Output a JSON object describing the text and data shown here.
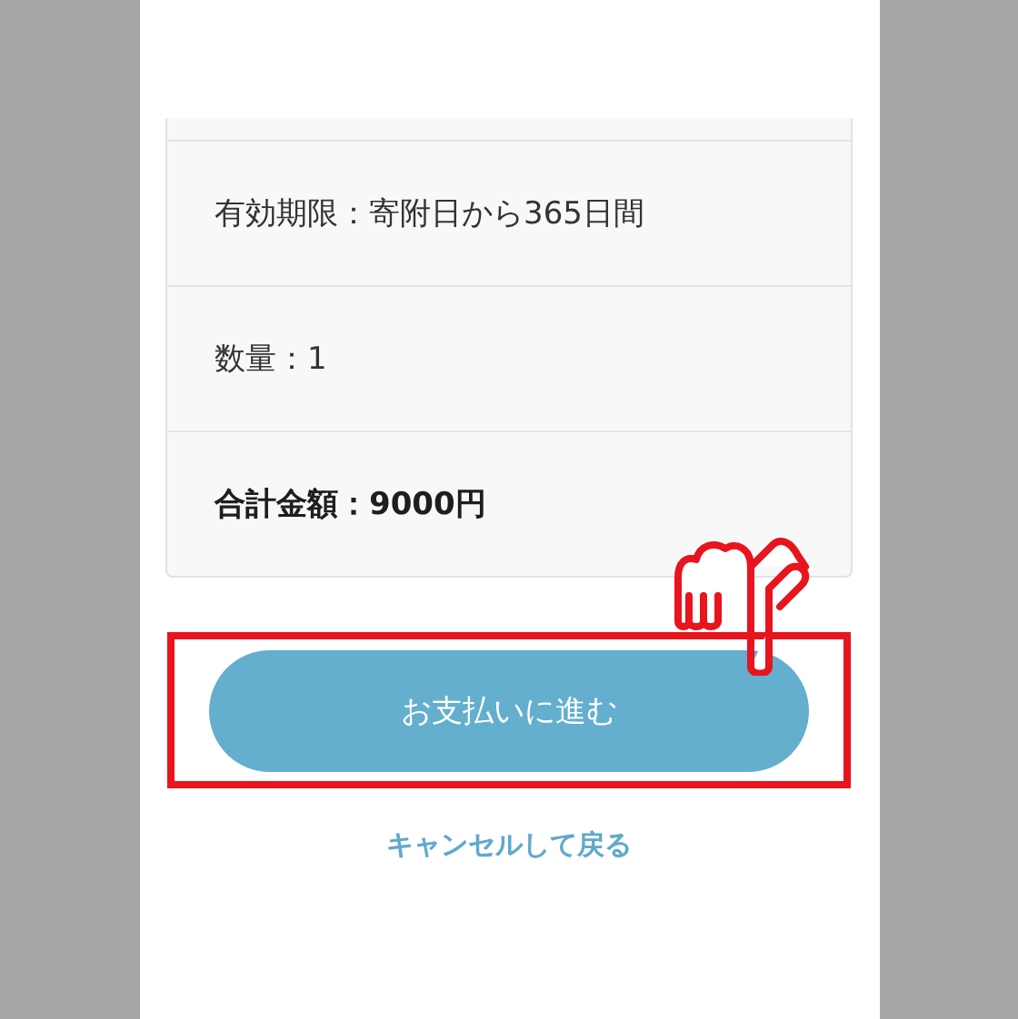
{
  "details": [
    {
      "kind": "plain",
      "text": "有効期限：寄附日から365日間"
    },
    {
      "kind": "plain",
      "text": "数量：1"
    },
    {
      "kind": "total",
      "text": "合計金額：9000円"
    }
  ],
  "pay_button": {
    "label": "お支払いに進む"
  },
  "cancel_link": {
    "label": "キャンセルして戻る"
  }
}
